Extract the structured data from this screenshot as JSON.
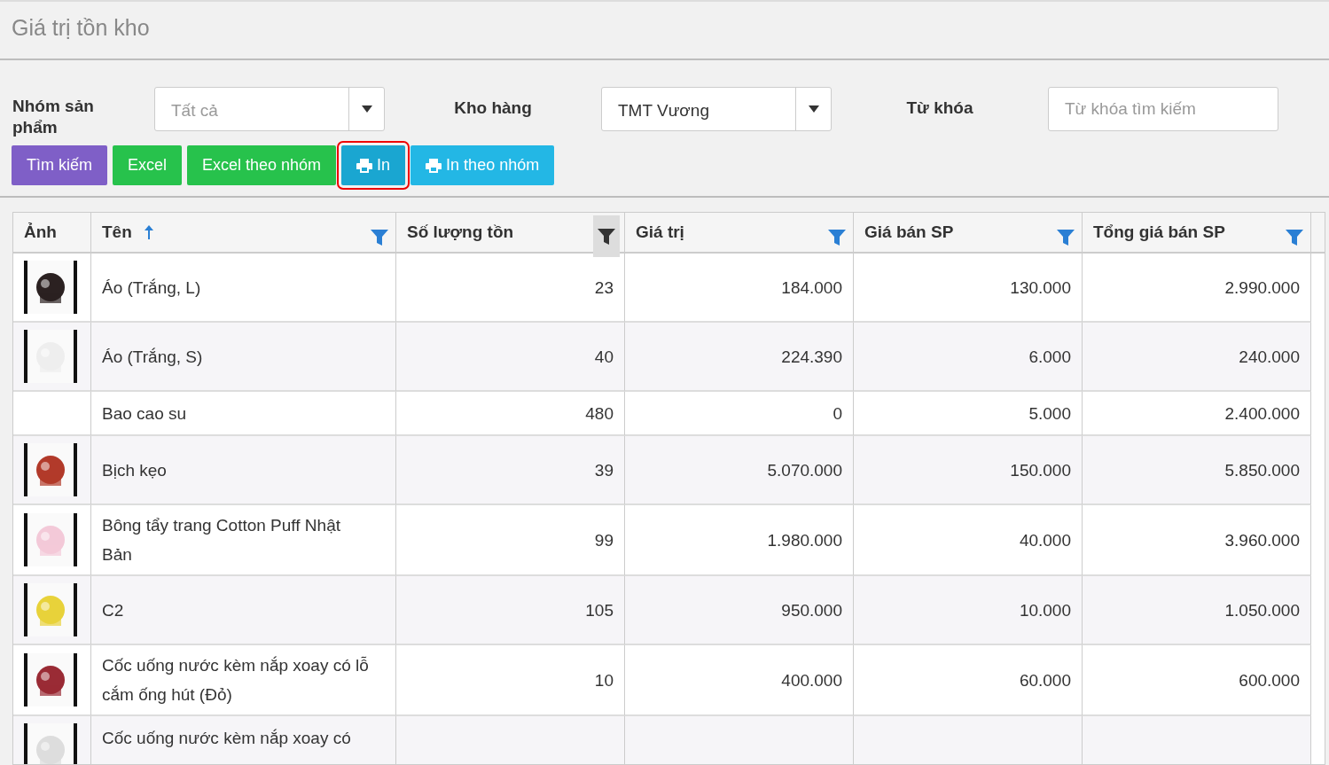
{
  "page_title": "Giá trị tồn kho",
  "filters": [
    {
      "label": "Nhóm sản phẩm",
      "kind": "select",
      "placeholder": "Tất cả"
    },
    {
      "label": "Kho hàng",
      "kind": "select",
      "value": "TMT Vương"
    },
    {
      "label": "Từ khóa",
      "kind": "input",
      "placeholder": "Từ khóa tìm kiếm"
    }
  ],
  "buttons": [
    {
      "label": "Tìm kiếm",
      "kind": "search",
      "print_icon": false,
      "highlighted": false
    },
    {
      "label": "Excel",
      "kind": "excel",
      "print_icon": false,
      "highlighted": false
    },
    {
      "label": "Excel theo nhóm",
      "kind": "excel",
      "print_icon": false,
      "highlighted": false
    },
    {
      "label": "In",
      "kind": "print",
      "print_icon": true,
      "highlighted": true
    },
    {
      "label": "In theo nhóm",
      "kind": "print",
      "print_icon": true,
      "highlighted": false
    }
  ],
  "table": {
    "image_column": {
      "label": "Ảnh"
    },
    "columns": [
      {
        "label": "Tên",
        "sorted_ascending": true,
        "filter_active": false
      },
      {
        "label": "Số lượng tồn",
        "sorted_ascending": false,
        "filter_active": true
      },
      {
        "label": "Giá trị",
        "sorted_ascending": false,
        "filter_active": false
      },
      {
        "label": "Giá bán SP",
        "sorted_ascending": false,
        "filter_active": false
      },
      {
        "label": "Tổng giá bán SP",
        "sorted_ascending": false,
        "filter_active": false
      }
    ],
    "rows": [
      {
        "has_image": true,
        "cells": [
          "Áo (Trắng, L)",
          "23",
          "184.000",
          "130.000",
          "2.990.000"
        ]
      },
      {
        "has_image": true,
        "cells": [
          "Áo (Trắng, S)",
          "40",
          "224.390",
          "6.000",
          "240.000"
        ]
      },
      {
        "has_image": false,
        "cells": [
          "Bao cao su",
          "480",
          "0",
          "5.000",
          "2.400.000"
        ]
      },
      {
        "has_image": true,
        "cells": [
          "Bịch kẹo",
          "39",
          "5.070.000",
          "150.000",
          "5.850.000"
        ]
      },
      {
        "has_image": true,
        "cells": [
          "Bông tẩy trang Cotton Puff Nhật Bản",
          "99",
          "1.980.000",
          "40.000",
          "3.960.000"
        ]
      },
      {
        "has_image": true,
        "cells": [
          "C2",
          "105",
          "950.000",
          "10.000",
          "1.050.000"
        ]
      },
      {
        "has_image": true,
        "cells": [
          "Cốc uống nước kèm nắp xoay có lỗ cắm ống hút (Đỏ)",
          "10",
          "400.000",
          "60.000",
          "600.000"
        ]
      },
      {
        "has_image": true,
        "cells": [
          "Cốc uống nước kèm nắp xoay có"
        ]
      }
    ]
  }
}
